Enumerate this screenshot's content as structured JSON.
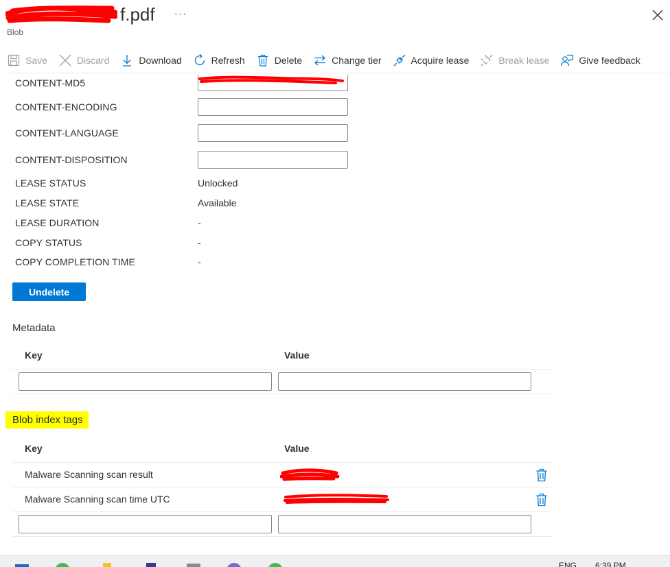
{
  "header": {
    "title_suffix": "f.pdf",
    "more": "···",
    "subtitle": "Blob"
  },
  "toolbar": {
    "save": "Save",
    "discard": "Discard",
    "download": "Download",
    "refresh": "Refresh",
    "delete": "Delete",
    "change_tier": "Change tier",
    "acquire_lease": "Acquire lease",
    "break_lease": "Break lease",
    "give_feedback": "Give feedback"
  },
  "properties": {
    "content_md5": "CONTENT-MD5",
    "content_encoding": "CONTENT-ENCODING",
    "content_language": "CONTENT-LANGUAGE",
    "content_disposition": "CONTENT-DISPOSITION",
    "lease_status": {
      "label": "LEASE STATUS",
      "value": "Unlocked"
    },
    "lease_state": {
      "label": "LEASE STATE",
      "value": "Available"
    },
    "lease_duration": {
      "label": "LEASE DURATION",
      "value": "-"
    },
    "copy_status": {
      "label": "COPY STATUS",
      "value": "-"
    },
    "copy_completion_time": {
      "label": "COPY COMPLETION TIME",
      "value": "-"
    }
  },
  "undelete_label": "Undelete",
  "metadata": {
    "title": "Metadata",
    "key_header": "Key",
    "value_header": "Value"
  },
  "index_tags": {
    "title": "Blob index tags",
    "key_header": "Key",
    "value_header": "Value",
    "rows": [
      {
        "key": "Malware Scanning scan result"
      },
      {
        "key": "Malware Scanning scan time UTC"
      }
    ]
  },
  "taskbar": {
    "language": "ENG",
    "time": "6:39 PM"
  },
  "colors": {
    "accent": "#0078d4",
    "highlight": "#ffff00",
    "redaction": "#ff0000"
  }
}
